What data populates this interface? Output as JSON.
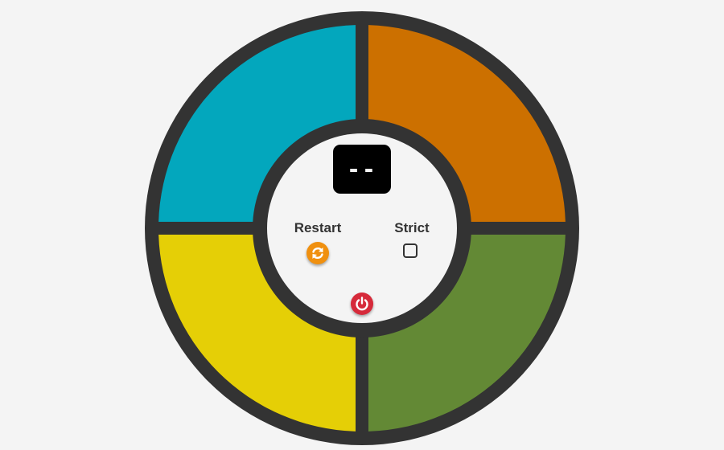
{
  "game": {
    "count_display": "--",
    "strict_mode": false
  },
  "controls": {
    "restart_label": "Restart",
    "strict_label": "Strict",
    "restart_icon": "refresh-icon",
    "power_icon": "power-icon"
  },
  "colors": {
    "background": "#f4f4f4",
    "frame": "#333333",
    "blue": "#03a7bd",
    "orange": "#cc7000",
    "yellow": "#e5cf06",
    "green": "#638935",
    "restart_button": "#f0900f",
    "power_button": "#d62a3a",
    "display": "#000000"
  }
}
